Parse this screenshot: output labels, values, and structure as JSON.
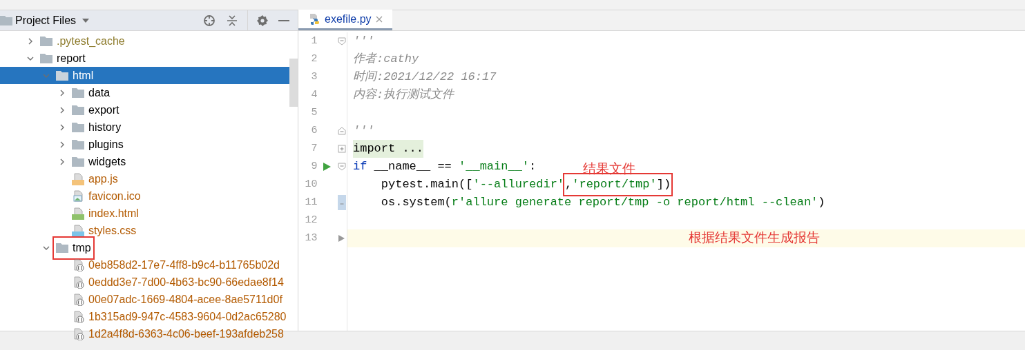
{
  "sidebar": {
    "title": "Project Files",
    "tree": [
      {
        "name": ".pytest_cache",
        "kind": "folder",
        "expanded": false,
        "selected": false,
        "boxed": false,
        "color": "#8c7a2a"
      },
      {
        "name": "report",
        "kind": "folder",
        "expanded": true,
        "selected": false,
        "boxed": false,
        "color": "#000000",
        "children": [
          {
            "name": "html",
            "kind": "folder",
            "expanded": true,
            "selected": true,
            "boxed": false,
            "children": [
              {
                "name": "data",
                "kind": "folder",
                "expanded": false,
                "selected": false,
                "boxed": false,
                "color": "#000000"
              },
              {
                "name": "export",
                "kind": "folder",
                "expanded": false,
                "selected": false,
                "boxed": false,
                "color": "#000000"
              },
              {
                "name": "history",
                "kind": "folder",
                "expanded": false,
                "selected": false,
                "boxed": false,
                "color": "#000000"
              },
              {
                "name": "plugins",
                "kind": "folder",
                "expanded": false,
                "selected": false,
                "boxed": false,
                "color": "#000000"
              },
              {
                "name": "widgets",
                "kind": "folder",
                "expanded": false,
                "selected": false,
                "boxed": false,
                "color": "#000000"
              },
              {
                "name": "app.js",
                "kind": "js",
                "selected": false,
                "boxed": false,
                "color": "#b35a00"
              },
              {
                "name": "favicon.ico",
                "kind": "image",
                "selected": false,
                "boxed": false,
                "color": "#b35a00"
              },
              {
                "name": "index.html",
                "kind": "html",
                "selected": false,
                "boxed": false,
                "color": "#b35a00"
              },
              {
                "name": "styles.css",
                "kind": "css",
                "selected": false,
                "boxed": false,
                "color": "#b35a00"
              }
            ]
          },
          {
            "name": "tmp",
            "kind": "folder",
            "expanded": true,
            "selected": false,
            "boxed": true,
            "color": "#000000",
            "children": [
              {
                "name": "0eb858d2-17e7-4ff8-b9c4-b11765b02d",
                "kind": "json",
                "selected": false,
                "boxed": false,
                "color": "#b35a00"
              },
              {
                "name": "0eddd3e7-7d00-4b63-bc90-66edae8f14",
                "kind": "json",
                "selected": false,
                "boxed": false,
                "color": "#b35a00"
              },
              {
                "name": "00e07adc-1669-4804-acee-8ae5711d0f",
                "kind": "json",
                "selected": false,
                "boxed": false,
                "color": "#b35a00"
              },
              {
                "name": "1b315ad9-947c-4583-9604-0d2ac65280",
                "kind": "json",
                "selected": false,
                "boxed": false,
                "color": "#b35a00"
              },
              {
                "name": "1d2a4f8d-6363-4c06-beef-193afdeb258",
                "kind": "json",
                "selected": false,
                "boxed": false,
                "color": "#b35a00"
              }
            ]
          }
        ]
      }
    ]
  },
  "tabs": [
    {
      "label": "exefile.py",
      "selected": true
    }
  ],
  "editor": {
    "lines": [
      {
        "number": "1",
        "kind": "fold-start",
        "current": false,
        "runnable": false,
        "tokens": [
          {
            "text": "'''",
            "kind": "comment"
          }
        ]
      },
      {
        "number": "2",
        "kind": "plain",
        "current": false,
        "runnable": false,
        "tokens": [
          {
            "text": "作者:cathy",
            "kind": "comment"
          }
        ]
      },
      {
        "number": "3",
        "kind": "plain",
        "current": false,
        "runnable": false,
        "tokens": [
          {
            "text": "时间:2021/12/22 16:17",
            "kind": "comment"
          }
        ]
      },
      {
        "number": "4",
        "kind": "plain",
        "current": false,
        "runnable": false,
        "tokens": [
          {
            "text": "内容:执行测试文件",
            "kind": "comment"
          }
        ]
      },
      {
        "number": "5",
        "kind": "plain",
        "current": false,
        "runnable": false
      },
      {
        "number": "6",
        "kind": "fold-end",
        "current": false,
        "runnable": false,
        "tokens": [
          {
            "text": "'''",
            "kind": "comment"
          }
        ]
      },
      {
        "number": "7",
        "kind": "collapsed",
        "current": false,
        "runnable": false,
        "tokens": [
          {
            "text": "import ...",
            "kind": "folded"
          }
        ]
      },
      {
        "number": "9",
        "kind": "fold-start",
        "current": false,
        "runnable": true,
        "tokens": [
          {
            "text": "if",
            "kind": "keyword"
          },
          {
            "text": " __name__ == ",
            "kind": "plain"
          },
          {
            "text": "'__main__'",
            "kind": "string"
          },
          {
            "text": ":",
            "kind": "plain"
          }
        ]
      },
      {
        "number": "10",
        "kind": "plain",
        "current": false,
        "runnable": false,
        "tokens": [
          {
            "text": "    pytest.main([",
            "kind": "plain",
            "boxed": false
          },
          {
            "text": "'--alluredir'",
            "kind": "string",
            "boxed": false
          },
          {
            "text": ",",
            "kind": "plain",
            "boxed": true
          },
          {
            "text": "'report/tmp'",
            "kind": "string",
            "boxed": true
          },
          {
            "text": "])",
            "kind": "plain",
            "boxed": true
          }
        ]
      },
      {
        "number": "11",
        "kind": "fold-end-active",
        "current": false,
        "runnable": false,
        "tokens": [
          {
            "text": "    os.system(",
            "kind": "plain"
          },
          {
            "text": "r'allure generate report/tmp -o report/html --clean'",
            "kind": "string"
          },
          {
            "text": ")",
            "kind": "plain"
          }
        ]
      },
      {
        "number": "12",
        "kind": "plain",
        "current": false,
        "runnable": false
      },
      {
        "number": "13",
        "kind": "plain",
        "current": true,
        "runnable": false
      }
    ]
  },
  "annotations": [
    {
      "text": "结果文件"
    },
    {
      "text": "根据结果文件生成报告"
    }
  ]
}
